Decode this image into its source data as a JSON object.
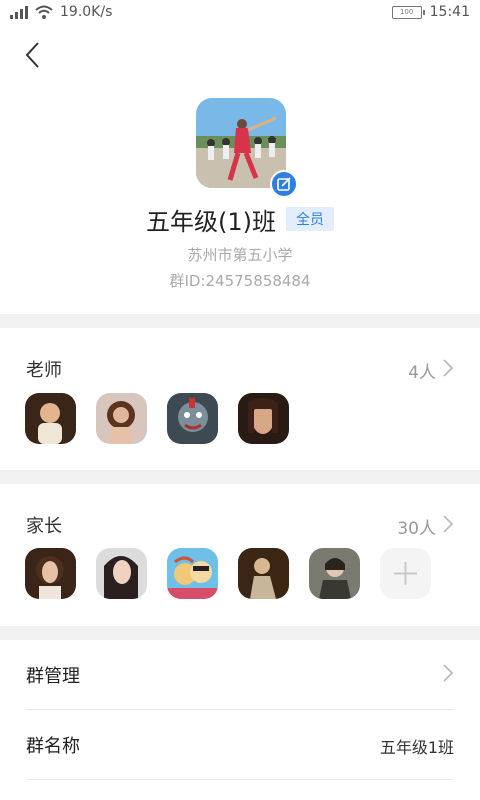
{
  "status_bar": {
    "speed": "19.0K/s",
    "battery": "100",
    "time": "15:41"
  },
  "group": {
    "name": "五年级(1)班",
    "tag": "全员",
    "school": "苏州市第五小学",
    "group_id": "群ID:24575858484"
  },
  "teachers": {
    "title": "老师",
    "count": "4人",
    "avatars": [
      "avatar-child",
      "avatar-curly-hair",
      "avatar-cartoon-face",
      "avatar-woman-portrait"
    ]
  },
  "parents": {
    "title": "家长",
    "count": "30人",
    "avatars": [
      "avatar-woman-curly",
      "avatar-woman-smile",
      "avatar-cartoon-couple",
      "avatar-woman-warm",
      "avatar-woman-scarf"
    ]
  },
  "settings": [
    {
      "label": "群管理",
      "value": ""
    },
    {
      "label": "群名称",
      "value": "五年级1班"
    }
  ],
  "colors": {
    "accent": "#2f7fe0",
    "tag_bg": "#e3eefc",
    "band": "#f2f2f2"
  }
}
